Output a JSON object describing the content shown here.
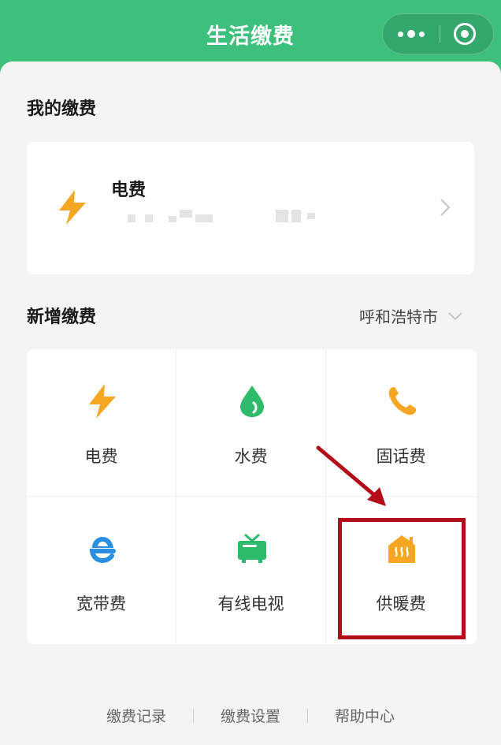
{
  "header": {
    "title": "生活缴费",
    "capsule_icons": [
      "more-icon",
      "close-target-icon"
    ]
  },
  "my_payments": {
    "section_title": "我的缴费",
    "items": [
      {
        "name": "电费",
        "icon": "lightning-icon",
        "account": ""
      }
    ]
  },
  "new_payment": {
    "section_title": "新增缴费",
    "city": "呼和浩特市",
    "options": [
      {
        "label": "电费",
        "icon": "lightning-icon",
        "color": "#f5a623"
      },
      {
        "label": "水费",
        "icon": "water-drop-icon",
        "color": "#2dbb6b"
      },
      {
        "label": "固话费",
        "icon": "phone-icon",
        "color": "#f5a623"
      },
      {
        "label": "宽带费",
        "icon": "browser-e-icon",
        "color": "#2a8fe0"
      },
      {
        "label": "有线电视",
        "icon": "tv-icon",
        "color": "#2dbb6b"
      },
      {
        "label": "供暖费",
        "icon": "heating-icon",
        "color": "#f5a623"
      }
    ],
    "highlighted": "供暖费"
  },
  "footer": {
    "links": [
      "缴费记录",
      "缴费设置",
      "帮助中心"
    ]
  },
  "colors": {
    "brand_green": "#3cc07c",
    "annotation_red": "#b30d1a"
  }
}
